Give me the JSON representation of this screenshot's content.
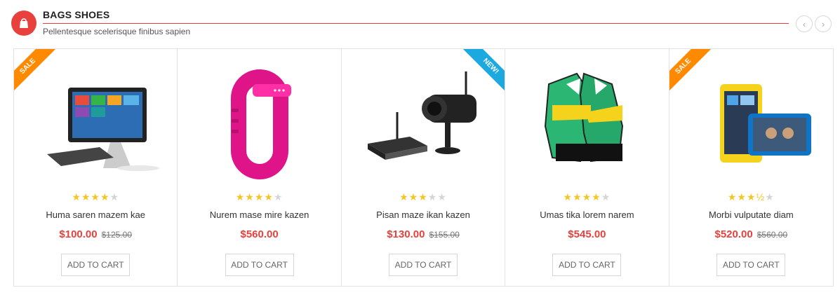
{
  "header": {
    "title": "BAGS SHOES",
    "subtitle": "Pellentesque scelerisque finibus sapien",
    "category_icon": "bag-icon",
    "prev_icon": "chevron-left-icon",
    "next_icon": "chevron-right-icon",
    "accent_color": "#e8403c"
  },
  "products": [
    {
      "ribbon": "SALE",
      "ribbon_color": "#ff8a00",
      "image": "all-in-one-computer",
      "rating": 4,
      "name": "Huma saren mazem kae",
      "price": "$100.00",
      "old_price": "$125.00",
      "cart_label": "ADD TO CART"
    },
    {
      "ribbon": "",
      "image": "pink-fitness-band",
      "rating": 4,
      "name": "Nurem mase mire kazen",
      "price": "$560.00",
      "old_price": "",
      "cart_label": "ADD TO CART"
    },
    {
      "ribbon": "NEW!",
      "ribbon_color": "#1ba9e0",
      "image": "security-camera",
      "rating": 3,
      "name": "Pisan maze ikan kazen",
      "price": "$130.00",
      "old_price": "$155.00",
      "cart_label": "ADD TO CART"
    },
    {
      "ribbon": "",
      "image": "goalkeeper-gloves",
      "rating": 4,
      "name": "Umas tika lorem narem",
      "price": "$545.00",
      "old_price": "",
      "cart_label": "ADD TO CART"
    },
    {
      "ribbon": "SALE",
      "ribbon_color": "#ff8a00",
      "image": "smartphones",
      "rating": 3.5,
      "name": "Morbi vulputate diam",
      "price": "$520.00",
      "old_price": "$560.00",
      "cart_label": "ADD TO CART"
    }
  ]
}
